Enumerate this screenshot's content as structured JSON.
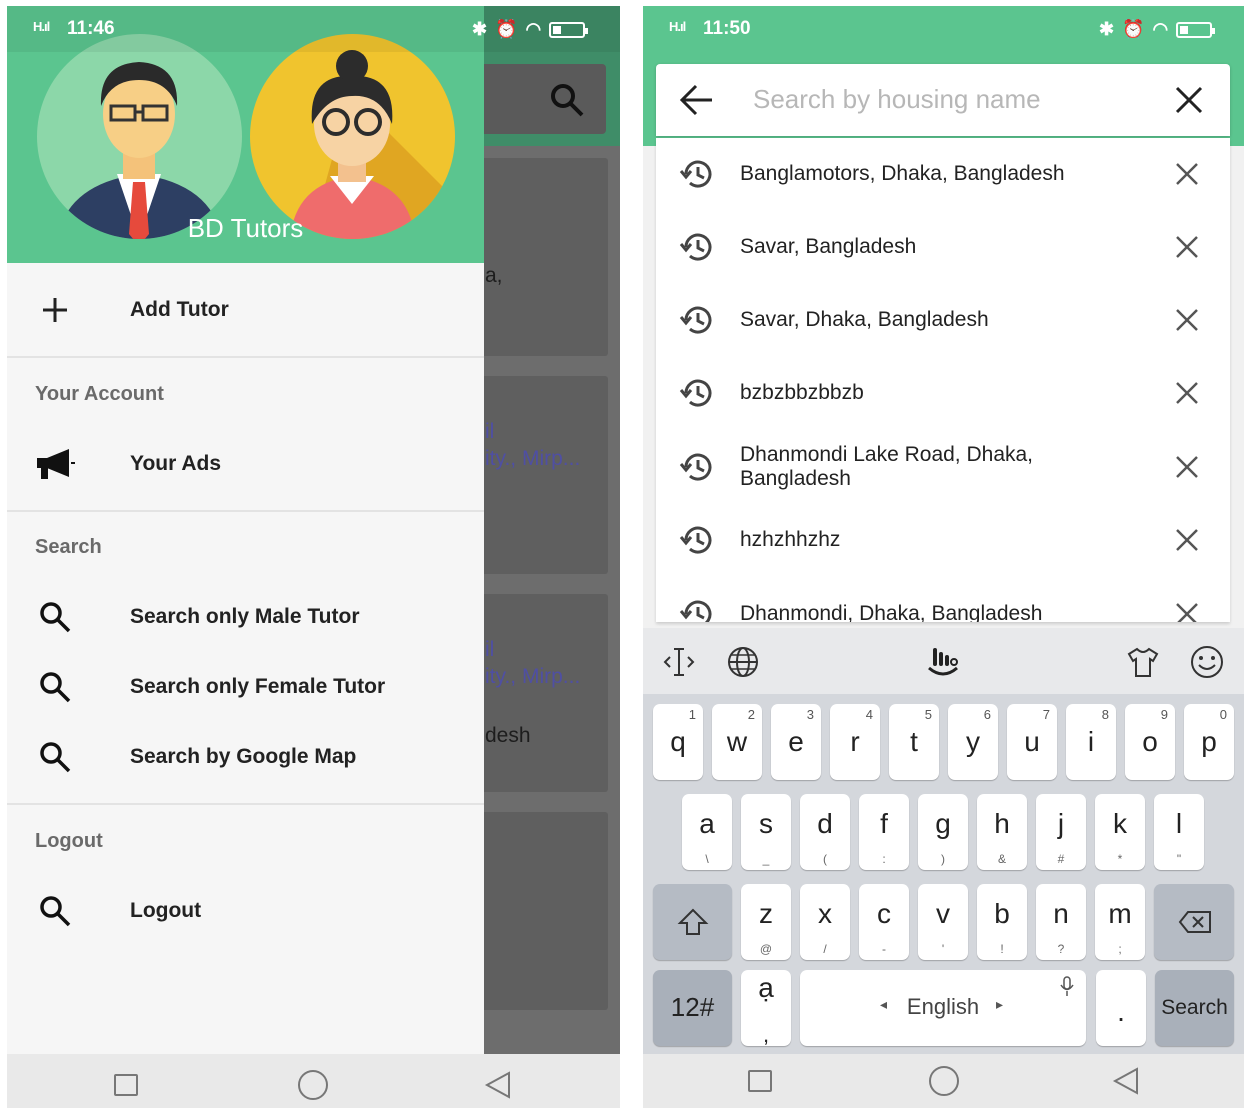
{
  "left": {
    "status": {
      "signal": "H.ıl",
      "time": "11:46"
    },
    "drawer": {
      "app_name": "BD Tutors",
      "add_tutor": "Add Tutor",
      "section_account": "Your Account",
      "your_ads": "Your Ads",
      "section_search": "Search",
      "search_male": "Search only Male Tutor",
      "search_female": "Search only Female Tutor",
      "search_map": "Search by Google Map",
      "section_logout": "Logout",
      "logout": "Logout"
    },
    "background_text": {
      "t1": "a,",
      "t2": "il",
      "t3": "ity., Mirp...",
      "t4": "il",
      "t5": "ity., Mirp...",
      "t6": "desh"
    }
  },
  "right": {
    "status": {
      "signal": "H.ıl",
      "time": "11:50"
    },
    "search": {
      "placeholder": "Search by housing name"
    },
    "history": [
      {
        "text": "Banglamotors, Dhaka, Bangladesh"
      },
      {
        "text": "Savar, Bangladesh"
      },
      {
        "text": "Savar, Dhaka, Bangladesh"
      },
      {
        "text": "bzbzbbzbbzb"
      },
      {
        "text": "Dhanmondi Lake Road, Dhaka, Bangladesh"
      },
      {
        "text": "hzhzhhzhz"
      },
      {
        "text": "Dhanmondi, Dhaka, Bangladesh"
      }
    ],
    "keyboard": {
      "row1": [
        {
          "k": "q",
          "s": "1"
        },
        {
          "k": "w",
          "s": "2"
        },
        {
          "k": "e",
          "s": "3"
        },
        {
          "k": "r",
          "s": "4"
        },
        {
          "k": "t",
          "s": "5"
        },
        {
          "k": "y",
          "s": "6"
        },
        {
          "k": "u",
          "s": "7"
        },
        {
          "k": "i",
          "s": "8"
        },
        {
          "k": "o",
          "s": "9"
        },
        {
          "k": "p",
          "s": "0"
        }
      ],
      "row2": [
        {
          "k": "a",
          "s": "\\"
        },
        {
          "k": "s",
          "s": "_"
        },
        {
          "k": "d",
          "s": "("
        },
        {
          "k": "f",
          "s": ":"
        },
        {
          "k": "g",
          "s": ")"
        },
        {
          "k": "h",
          "s": "&"
        },
        {
          "k": "j",
          "s": "#"
        },
        {
          "k": "k",
          "s": "*"
        },
        {
          "k": "l",
          "s": "\""
        }
      ],
      "row3": [
        {
          "k": "z",
          "s": "@"
        },
        {
          "k": "x",
          "s": "/"
        },
        {
          "k": "c",
          "s": "-"
        },
        {
          "k": "v",
          "s": "'"
        },
        {
          "k": "b",
          "s": "!"
        },
        {
          "k": "n",
          "s": "?"
        },
        {
          "k": "m",
          "s": ";"
        }
      ],
      "numbers_key": "12#",
      "ime_key": "ạ",
      "comma": ",",
      "space_label": "English",
      "space_left": "◂",
      "space_right": "▸",
      "period": ".",
      "action_key": "Search"
    }
  },
  "colors": {
    "primary": "#5bc58f",
    "scrim": "#6d6d6d",
    "drawer_bg": "#f6f6f6",
    "keyboard_bg": "#d4d7dc"
  }
}
